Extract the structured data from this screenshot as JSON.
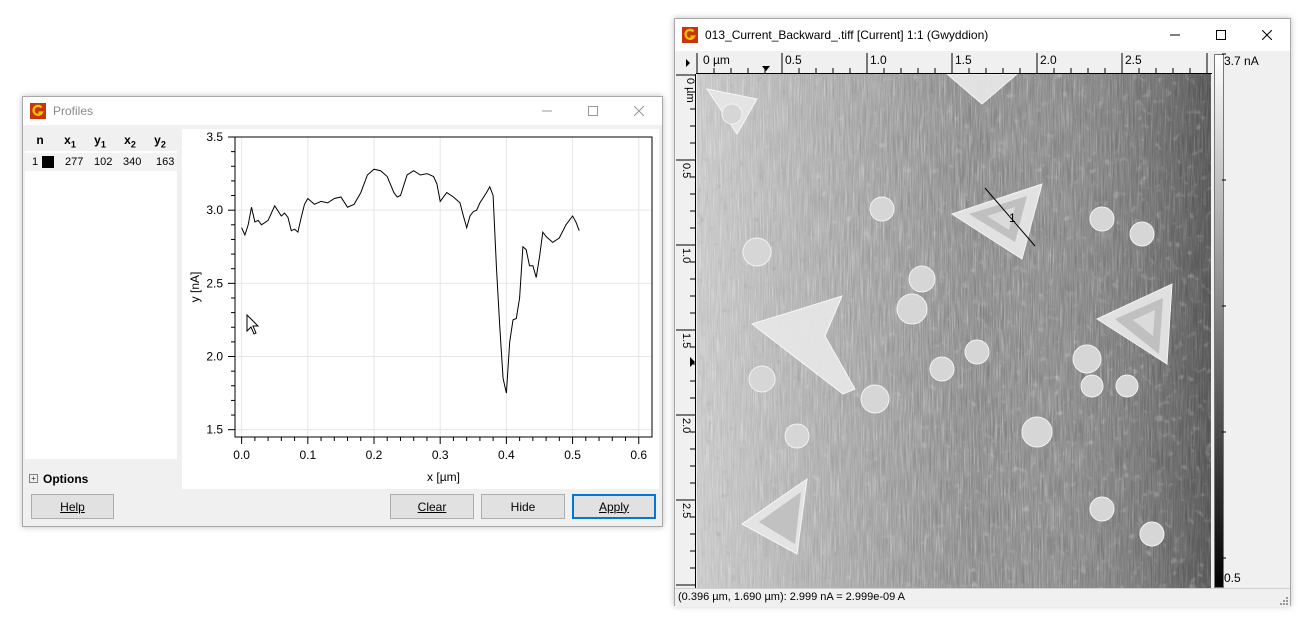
{
  "profiles": {
    "title": "Profiles",
    "table": {
      "headers": [
        "n",
        "x",
        "y",
        "x",
        "y"
      ],
      "header_subs": [
        "",
        "1",
        "1",
        "2",
        "2"
      ],
      "rows": [
        {
          "n": "1",
          "color": "#000000",
          "x1": "277",
          "y1": "102",
          "x2": "340",
          "y2": "163"
        }
      ]
    },
    "options_label": "Options",
    "buttons": {
      "help": "Help",
      "clear": "Clear",
      "hide": "Hide",
      "apply": "Apply"
    }
  },
  "image_window": {
    "title": "013_Current_Backward_.tiff [Current] 1:1 (Gwyddion)",
    "hruler": {
      "unit_label": "0 µm",
      "ticks": [
        "0.5",
        "1.0",
        "1.5",
        "2.0",
        "2.5"
      ]
    },
    "vruler": {
      "unit_label": "0 µm",
      "ticks": [
        "0.5",
        "1.0",
        "1.5",
        "2.0",
        "2.5"
      ]
    },
    "scale_max": "3.7 nA",
    "scale_min": "0.5",
    "profile_label": "1",
    "status": "(0.396 µm, 1.690 µm): 2.999 nA = 2.999e-09 A"
  },
  "colors": {
    "accent": "#0078d7",
    "icon_red": "#c8350c",
    "icon_yellow": "#f5c400"
  },
  "chart_data": {
    "type": "line",
    "title": "",
    "xlabel": "x [µm]",
    "ylabel": "y [nA]",
    "xlim": [
      -0.01,
      0.62
    ],
    "ylim": [
      1.45,
      3.5
    ],
    "xticks": [
      "0.0",
      "0.1",
      "0.2",
      "0.3",
      "0.4",
      "0.5",
      "0.6"
    ],
    "yticks": [
      "1.5",
      "2.0",
      "2.5",
      "3.0",
      "3.5"
    ],
    "grid": true,
    "series": [
      {
        "x": [
          0.0,
          0.005,
          0.01,
          0.015,
          0.02,
          0.025,
          0.03,
          0.04,
          0.05,
          0.06,
          0.065,
          0.07,
          0.075,
          0.08,
          0.085,
          0.09,
          0.095,
          0.1,
          0.11,
          0.12,
          0.13,
          0.14,
          0.15,
          0.16,
          0.17,
          0.18,
          0.19,
          0.2,
          0.21,
          0.22,
          0.23,
          0.235,
          0.24,
          0.25,
          0.26,
          0.27,
          0.28,
          0.29,
          0.295,
          0.3,
          0.31,
          0.32,
          0.33,
          0.335,
          0.34,
          0.345,
          0.35,
          0.355,
          0.36,
          0.37,
          0.375,
          0.38,
          0.385,
          0.39,
          0.395,
          0.4,
          0.405,
          0.41,
          0.415,
          0.42,
          0.425,
          0.43,
          0.435,
          0.44,
          0.445,
          0.45,
          0.455,
          0.46,
          0.47,
          0.48,
          0.49,
          0.5,
          0.505,
          0.51
        ],
        "y": [
          2.88,
          2.83,
          2.9,
          3.02,
          2.92,
          2.93,
          2.9,
          2.93,
          3.03,
          2.96,
          2.98,
          2.95,
          2.86,
          2.87,
          2.85,
          2.95,
          3.04,
          3.08,
          3.04,
          3.06,
          3.05,
          3.08,
          3.09,
          3.02,
          3.04,
          3.12,
          3.24,
          3.28,
          3.27,
          3.23,
          3.12,
          3.09,
          3.1,
          3.24,
          3.27,
          3.24,
          3.25,
          3.23,
          3.18,
          3.06,
          3.12,
          3.09,
          3.05,
          2.96,
          2.88,
          2.96,
          2.99,
          3.0,
          3.05,
          3.12,
          3.16,
          3.1,
          2.6,
          2.2,
          1.85,
          1.75,
          2.1,
          2.25,
          2.26,
          2.4,
          2.75,
          2.73,
          2.62,
          2.62,
          2.54,
          2.68,
          2.85,
          2.82,
          2.78,
          2.81,
          2.9,
          2.96,
          2.92,
          2.86
        ]
      }
    ]
  }
}
